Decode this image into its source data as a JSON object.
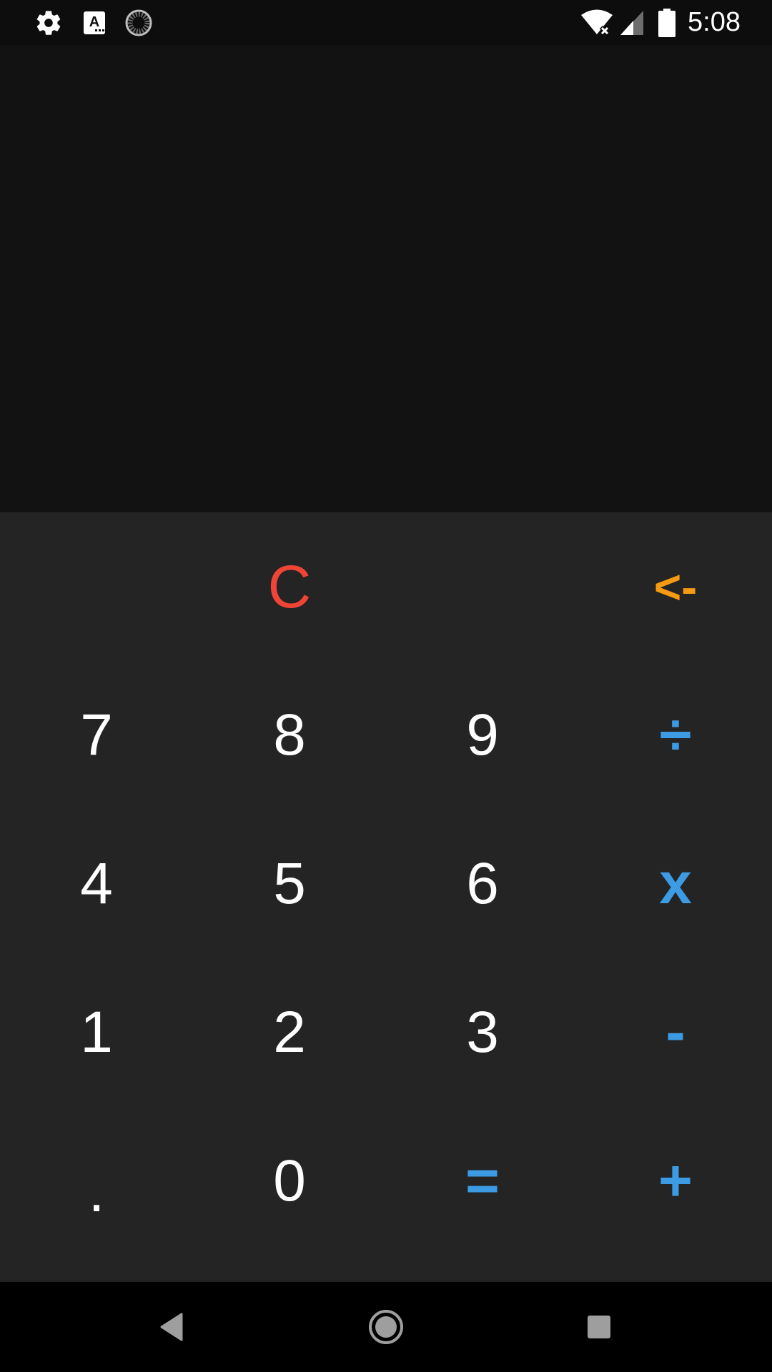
{
  "status_bar": {
    "time": "5:08",
    "left_icons": [
      "settings-icon",
      "text-a-icon",
      "loading-spinner-icon"
    ],
    "right_icons": [
      "wifi-off-icon",
      "cell-signal-icon",
      "battery-icon"
    ]
  },
  "display": {
    "expression": "",
    "result": ""
  },
  "keypad": {
    "rows": [
      [
        "",
        "C",
        "",
        "<-"
      ],
      [
        "7",
        "8",
        "9",
        "÷"
      ],
      [
        "4",
        "5",
        "6",
        "x"
      ],
      [
        "1",
        "2",
        "3",
        "-"
      ],
      [
        ".",
        "0",
        "=",
        "+"
      ]
    ]
  },
  "colors": {
    "digit": "#ffffff",
    "operator": "#3d9be3",
    "clear": "#f04536",
    "backspace": "#f59a12",
    "keypad_bg": "#242424",
    "display_bg": "#121212"
  },
  "navigation": {
    "icons": [
      "back-icon",
      "home-icon",
      "recents-icon"
    ]
  }
}
